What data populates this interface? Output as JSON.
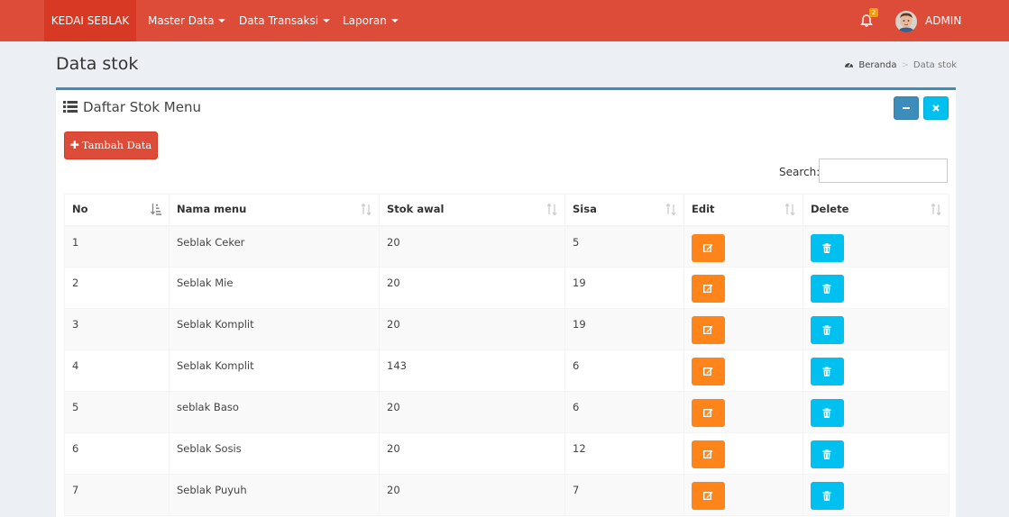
{
  "navbar": {
    "brand": "KEDAI SEBLAK",
    "menus": [
      {
        "label": "Master Data"
      },
      {
        "label": "Data Transaksi"
      },
      {
        "label": "Laporan"
      }
    ],
    "notification_count": "2",
    "user_name": "ADMIN"
  },
  "page": {
    "title": "Data stok",
    "breadcrumb": {
      "home": "Beranda",
      "current": "Data stok"
    }
  },
  "box": {
    "title": "Daftar Stok Menu",
    "add_button": "Tambah Data",
    "search_label": "Search:",
    "search_value": ""
  },
  "table": {
    "columns": [
      "No",
      "Nama menu",
      "Stok awal",
      "Sisa",
      "Edit",
      "Delete"
    ],
    "rows": [
      {
        "no": "1",
        "nama": "Seblak Ceker",
        "stok_awal": "20",
        "sisa": "5"
      },
      {
        "no": "2",
        "nama": "Seblak Mie",
        "stok_awal": "20",
        "sisa": "19"
      },
      {
        "no": "3",
        "nama": "Seblak Komplit",
        "stok_awal": "20",
        "sisa": "19"
      },
      {
        "no": "4",
        "nama": "Seblak Komplit",
        "stok_awal": "143",
        "sisa": "6"
      },
      {
        "no": "5",
        "nama": "seblak Baso",
        "stok_awal": "20",
        "sisa": "6"
      },
      {
        "no": "6",
        "nama": "Seblak Sosis",
        "stok_awal": "20",
        "sisa": "12"
      },
      {
        "no": "7",
        "nama": "Seblak Puyuh",
        "stok_awal": "20",
        "sisa": "7"
      }
    ]
  },
  "colors": {
    "header": "#dd4b39",
    "brand_bg": "#d73925",
    "box_border": "#3c8dbc",
    "edit_button": "#ff851b",
    "delete_button": "#00c0ef",
    "notification_badge": "#f39c12"
  },
  "icons": {
    "breadcrumb": "dashboard-icon",
    "box_title": "list-icon",
    "add": "plus-icon",
    "edit": "edit-icon",
    "delete": "trash-icon",
    "notification": "bell-icon",
    "sort_active": "sort-amount-asc-icon",
    "sort": "sort-icon"
  }
}
